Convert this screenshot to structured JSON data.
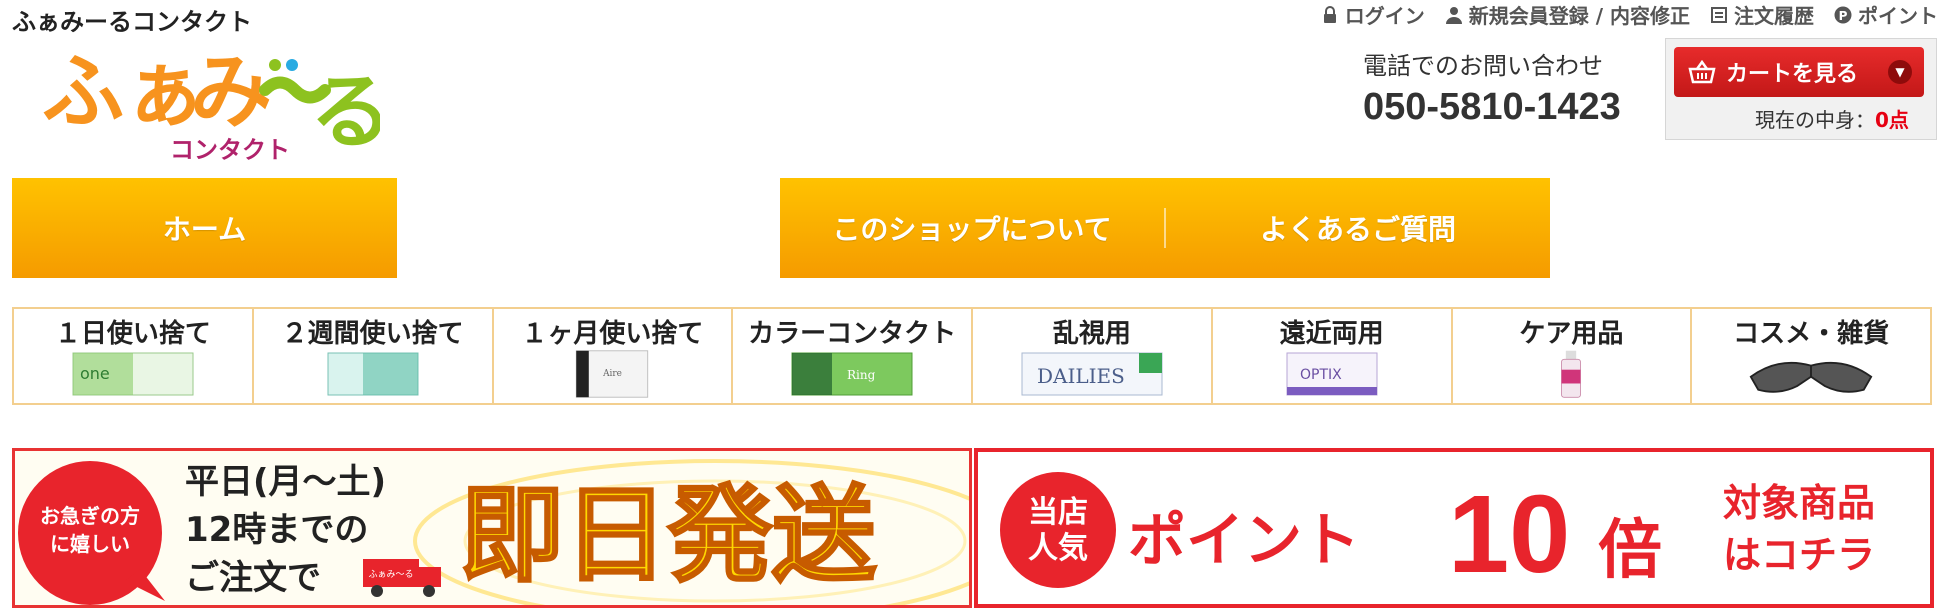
{
  "header": {
    "site_name": "ふぁみーるコンタクト",
    "logo_text": "ふぁみ〜る",
    "logo_sub": "コンタクト",
    "links": [
      {
        "label": "ログイン",
        "icon": "lock-icon"
      },
      {
        "label": "新規会員登録 / 内容修正",
        "icon": "user-icon"
      },
      {
        "label": "注文履歴",
        "icon": "document-icon"
      },
      {
        "label": "ポイント",
        "icon": "point-icon"
      }
    ],
    "tel_label": "電話でのお問い合わせ",
    "tel_number": "050-5810-1423"
  },
  "cart": {
    "button_label": "カートを見る",
    "status_label": "現在の中身：",
    "count": "0点"
  },
  "nav": {
    "home": "ホーム",
    "about": "このショップについて",
    "faq": "よくあるご質問"
  },
  "categories": [
    {
      "label": "１日使い捨て",
      "icon": "oneday-lens-box"
    },
    {
      "label": "２週間使い捨て",
      "icon": "twoweek-lens-box"
    },
    {
      "label": "１ヶ月使い捨て",
      "icon": "monthly-lens-box"
    },
    {
      "label": "カラーコンタクト",
      "icon": "color-lens-box"
    },
    {
      "label": "乱視用",
      "icon": "dailies-box"
    },
    {
      "label": "遠近両用",
      "icon": "optix-box"
    },
    {
      "label": "ケア用品",
      "icon": "care-bottle"
    },
    {
      "label": "コスメ・雑貨",
      "icon": "glasses"
    }
  ],
  "banners": {
    "same_day": {
      "badge": "お急ぎの方に嬉しい",
      "line1": "平日(月〜土)",
      "line2": "12時までの",
      "line3": "ご注文で",
      "truck_label": "ふぁみ〜る",
      "headline": "即日発送"
    },
    "points": {
      "badge_line1": "当店",
      "badge_line2": "人気",
      "headline": "ポイント",
      "number": "10",
      "suffix": "倍",
      "side_line1": "対象商品",
      "side_line2": "はコチラ"
    }
  },
  "colors": {
    "nav_orange": "#f7a800",
    "cart_red": "#d41f1f",
    "banner_red": "#e8242c",
    "same_day_yellow": "#ffd800"
  }
}
